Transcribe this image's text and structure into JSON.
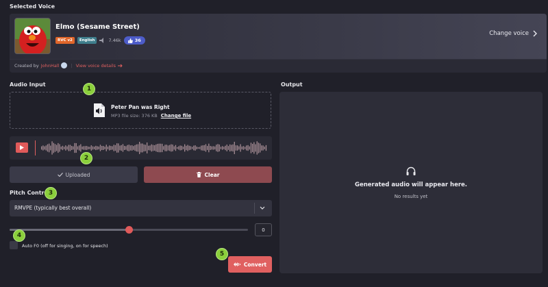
{
  "selected_voice": {
    "section_label": "Selected Voice",
    "name": "Elmo (Sesame Street)",
    "badges": [
      "RVC v2",
      "English"
    ],
    "plays": "7.46k",
    "likes": "36",
    "change_voice_label": "Change voice",
    "created_by_label": "Created by",
    "creator": "JohnHall",
    "details_link": "View voice details",
    "colors": {
      "accent": "#e05a5a",
      "badge_rvc": "#e0662a",
      "badge_lang": "#3f7e8c",
      "likes_pill": "#4d5cc8"
    }
  },
  "audio_input": {
    "section_label": "Audio Input",
    "file_name": "Peter Pan was Right",
    "file_meta": "MP3 file size: 376 KB",
    "change_file_label": "Change file",
    "uploaded_label": "Uploaded",
    "clear_label": "Clear"
  },
  "pitch_control": {
    "section_label": "Pitch Control",
    "selected_method": "RMVPE (typically best overall)",
    "slider_value": "0",
    "slider_fraction": 0.5,
    "auto_f0_label": "Auto F0 (off for singing, on for speech)",
    "convert_label": "Convert"
  },
  "output": {
    "section_label": "Output",
    "placeholder_title": "Generated audio will appear here.",
    "placeholder_sub": "No results yet"
  },
  "steps": [
    "1",
    "2",
    "3",
    "4",
    "5"
  ]
}
